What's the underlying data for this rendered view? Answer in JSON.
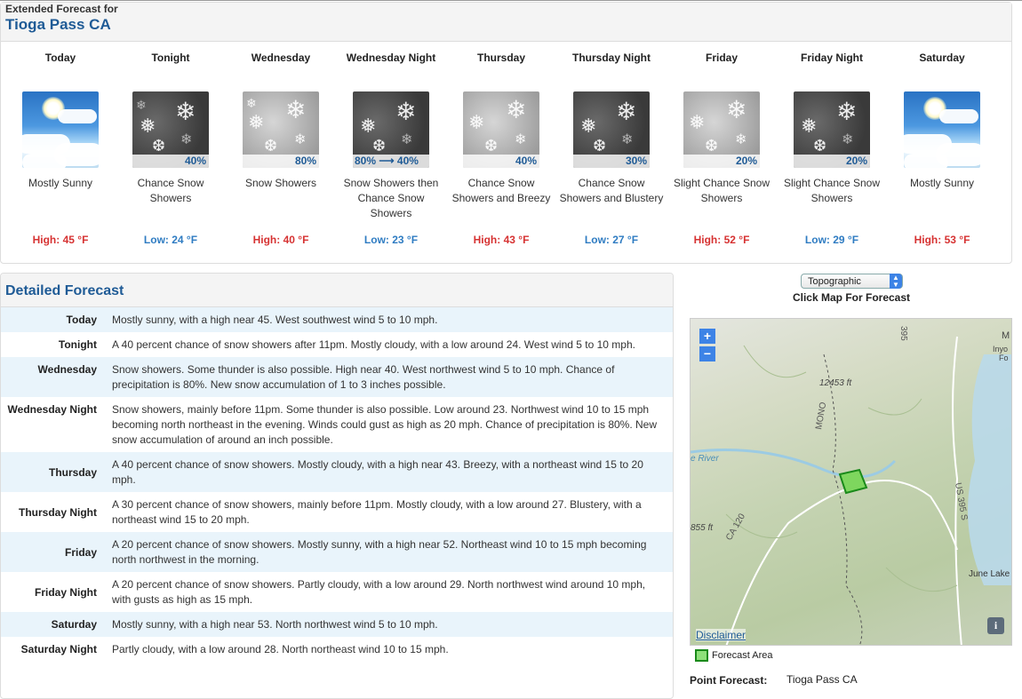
{
  "extended": {
    "label": "Extended Forecast for",
    "location": "Tioga Pass CA",
    "periods": [
      {
        "name": "Today",
        "desc": "Mostly Sunny",
        "temp": "High: 45 °F",
        "pop": ""
      },
      {
        "name": "Tonight",
        "desc": "Chance Snow Showers",
        "temp": "Low: 24 °F",
        "pop": "40%"
      },
      {
        "name": "Wednesday",
        "desc": "Snow Showers",
        "temp": "High: 40 °F",
        "pop": "80%"
      },
      {
        "name": "Wednesday Night",
        "desc": "Snow Showers then Chance Snow Showers",
        "temp": "Low: 23 °F",
        "pop": "80% ⟶ 40%"
      },
      {
        "name": "Thursday",
        "desc": "Chance Snow Showers and Breezy",
        "temp": "High: 43 °F",
        "pop": "40%"
      },
      {
        "name": "Thursday Night",
        "desc": "Chance Snow Showers and Blustery",
        "temp": "Low: 27 °F",
        "pop": "30%"
      },
      {
        "name": "Friday",
        "desc": "Slight Chance Snow Showers",
        "temp": "High: 52 °F",
        "pop": "20%"
      },
      {
        "name": "Friday Night",
        "desc": "Slight Chance Snow Showers",
        "temp": "Low: 29 °F",
        "pop": "20%"
      },
      {
        "name": "Saturday",
        "desc": "Mostly Sunny",
        "temp": "High: 53 °F",
        "pop": ""
      }
    ]
  },
  "detailed": {
    "title": "Detailed Forecast",
    "rows": [
      {
        "label": "Today",
        "text": "Mostly sunny, with a high near 45. West southwest wind 5 to 10 mph."
      },
      {
        "label": "Tonight",
        "text": "A 40 percent chance of snow showers after 11pm. Mostly cloudy, with a low around 24. West wind 5 to 10 mph."
      },
      {
        "label": "Wednesday",
        "text": "Snow showers. Some thunder is also possible. High near 40. West northwest wind 5 to 10 mph. Chance of precipitation is 80%. New snow accumulation of 1 to 3 inches possible."
      },
      {
        "label": "Wednesday Night",
        "text": "Snow showers, mainly before 11pm. Some thunder is also possible. Low around 23. Northwest wind 10 to 15 mph becoming north northeast in the evening. Winds could gust as high as 20 mph. Chance of precipitation is 80%. New snow accumulation of around an inch possible."
      },
      {
        "label": "Thursday",
        "text": "A 40 percent chance of snow showers. Mostly cloudy, with a high near 43. Breezy, with a northeast wind 15 to 20 mph."
      },
      {
        "label": "Thursday Night",
        "text": "A 30 percent chance of snow showers, mainly before 11pm. Mostly cloudy, with a low around 27. Blustery, with a northeast wind 15 to 20 mph."
      },
      {
        "label": "Friday",
        "text": "A 20 percent chance of snow showers. Mostly sunny, with a high near 52. Northeast wind 10 to 15 mph becoming north northwest in the morning."
      },
      {
        "label": "Friday Night",
        "text": "A 20 percent chance of snow showers. Partly cloudy, with a low around 29. North northwest wind around 10 mph, with gusts as high as 15 mph."
      },
      {
        "label": "Saturday",
        "text": "Mostly sunny, with a high near 53. North northwest wind 5 to 10 mph."
      },
      {
        "label": "Saturday Night",
        "text": "Partly cloudy, with a low around 28. North northeast wind 10 to 15 mph."
      }
    ]
  },
  "map": {
    "select_value": "Topographic",
    "caption": "Click Map For Forecast",
    "zoom_in": "+",
    "zoom_out": "−",
    "disclaimer": "Disclaimer",
    "info": "i",
    "labels": {
      "elev1": "12453 ft",
      "elev2": "855 ft",
      "road1": "395",
      "road2": "US 395 S",
      "road3": "CA 120",
      "region": "MONO",
      "river": "e River",
      "town1": "June Lake",
      "town2": "Inyo",
      "town3": "Fo",
      "corner": "M"
    },
    "legend": "Forecast Area",
    "point_label": "Point Forecast:",
    "point_value": "Tioga Pass CA"
  },
  "colors": {
    "accent": "#1f5b96",
    "high": "#d63232",
    "low": "#2f7cc2",
    "row_alt": "#e9f4fb"
  }
}
